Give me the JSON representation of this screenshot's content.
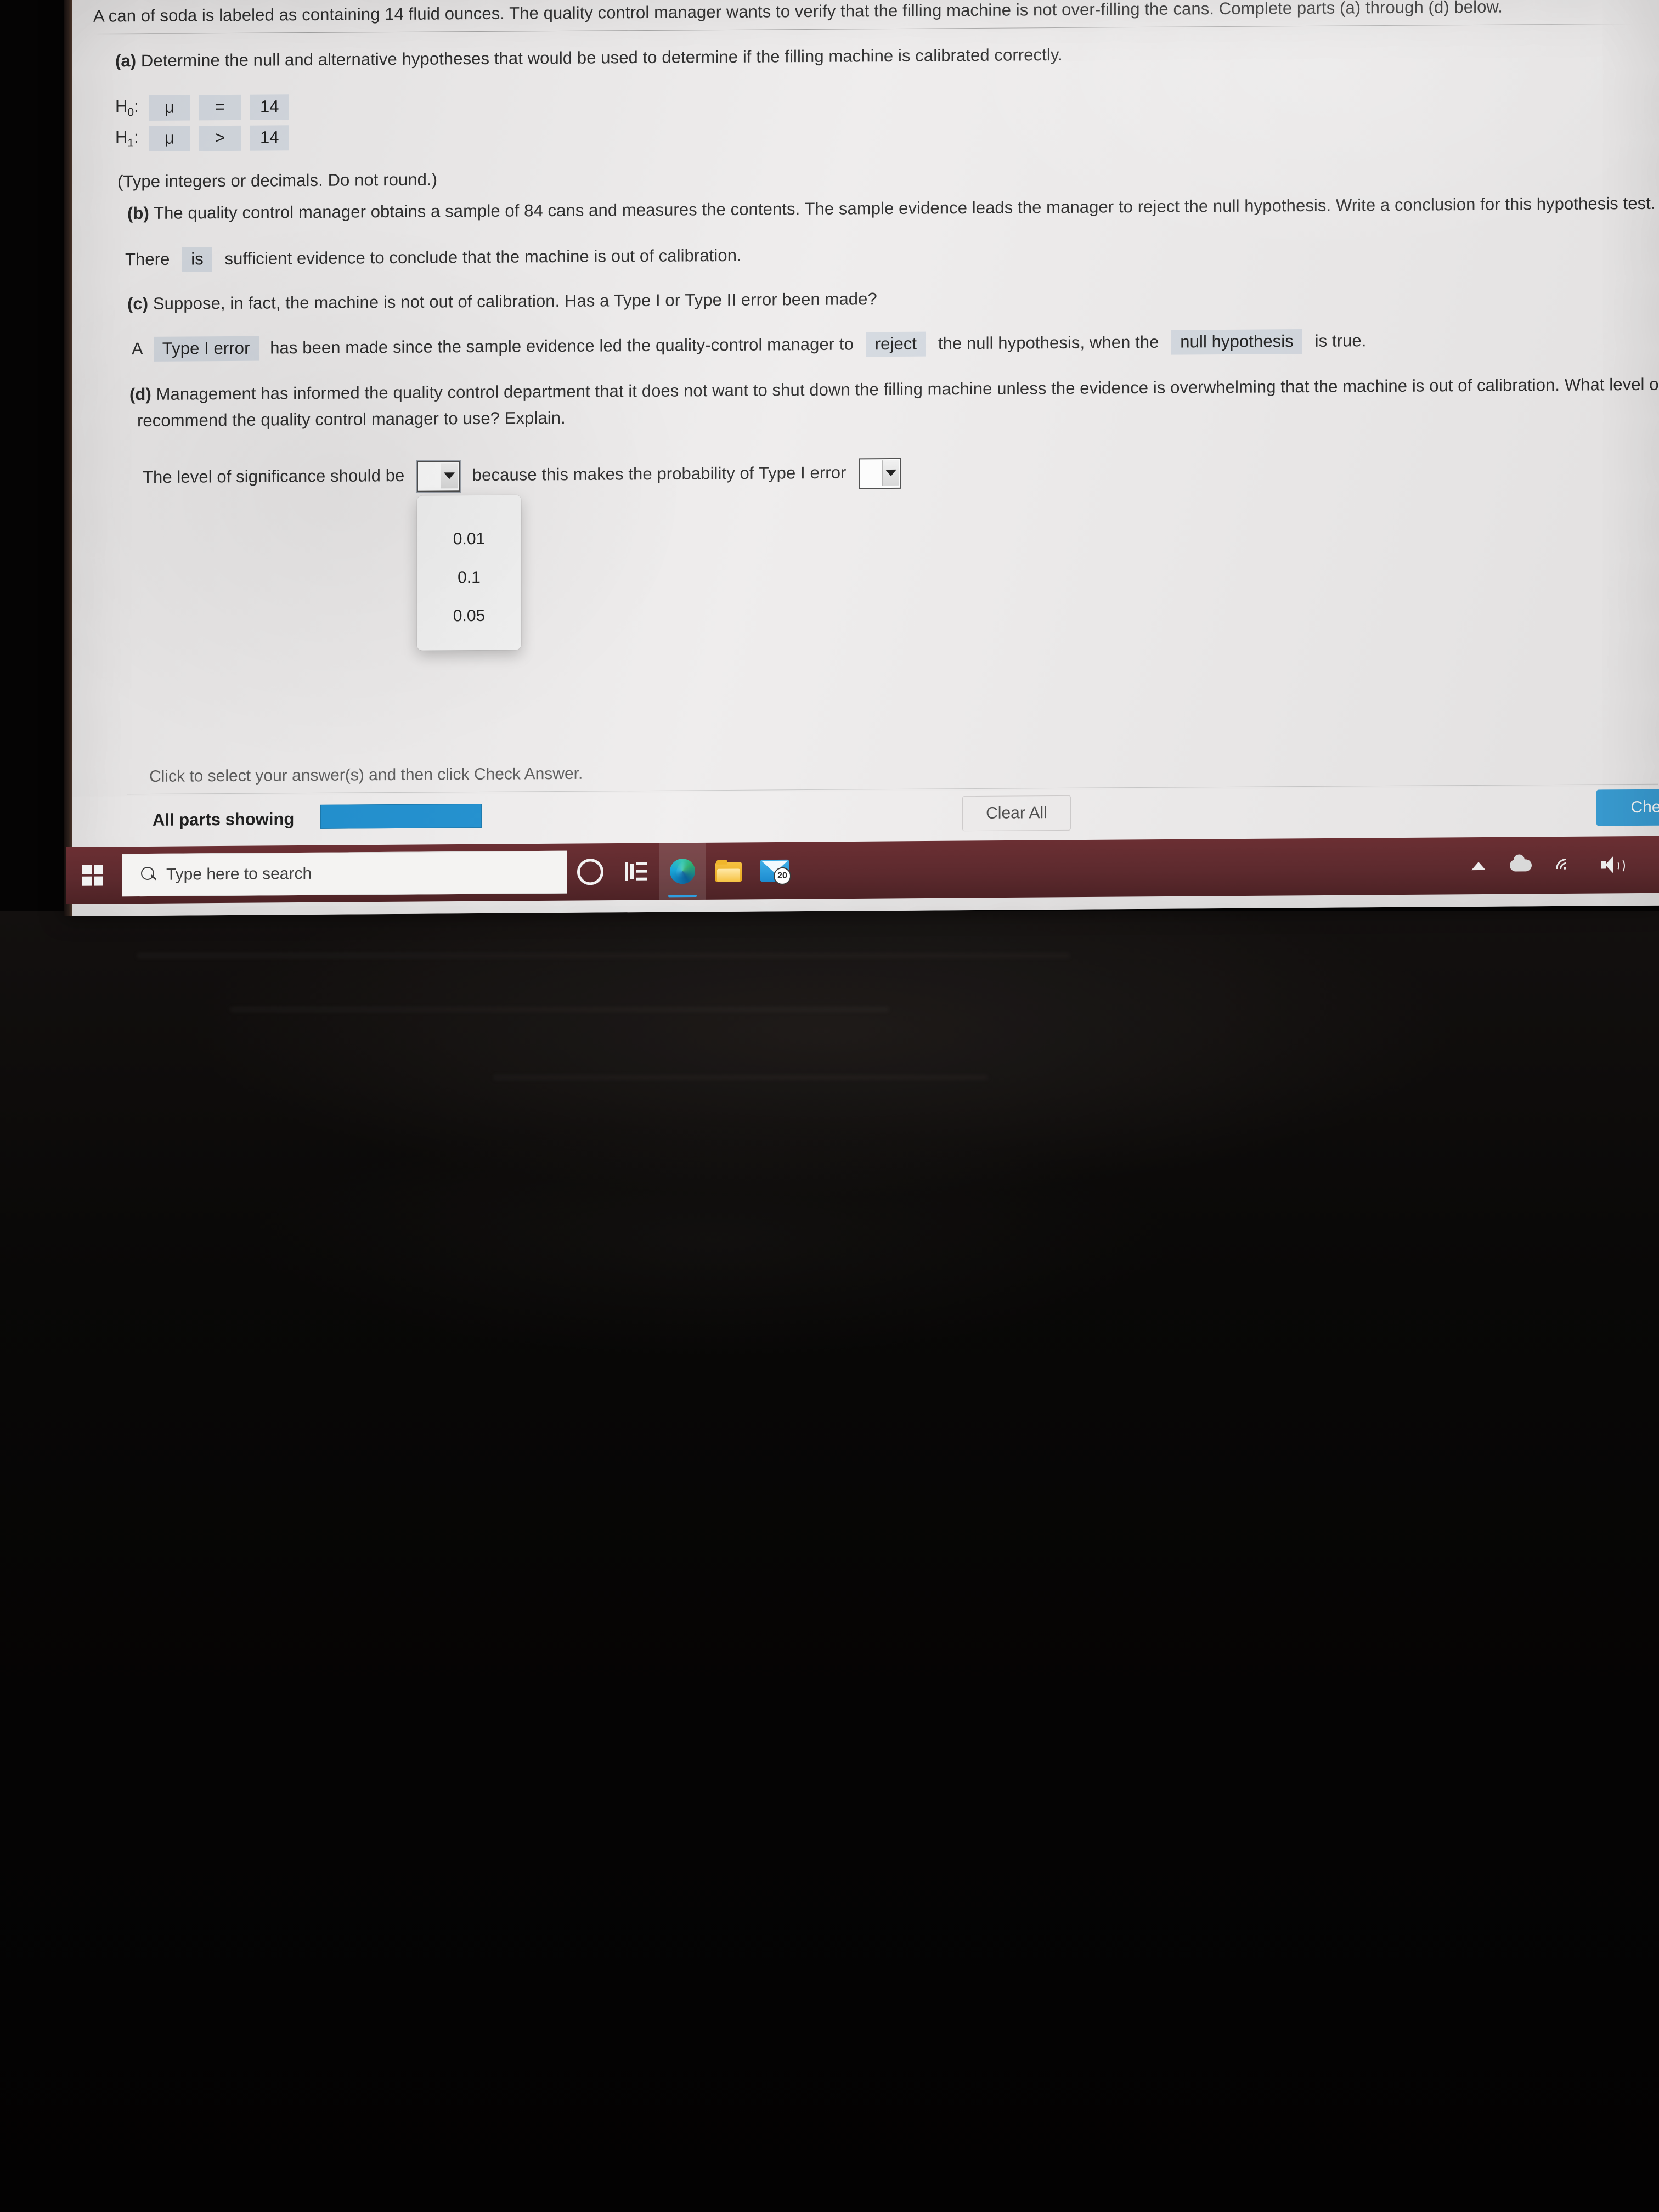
{
  "problem": {
    "stem": "A can of soda is labeled as containing 14 fluid ounces. The quality control manager wants to verify that the filling machine is not over-filling the cans. Complete parts (a) through (d) below.",
    "part_a": {
      "label": "(a)",
      "text": "Determine the null and alternative hypotheses that would be used to determine if the filling machine is calibrated correctly.",
      "h0_label": "H0:",
      "h0_param": "μ",
      "h0_operator": "=",
      "h0_value": "14",
      "h1_label": "H1:",
      "h1_param": "μ",
      "h1_operator": ">",
      "h1_value": "14",
      "note": "(Type integers or decimals. Do not round.)"
    },
    "part_b": {
      "label": "(b)",
      "text": "The quality control manager obtains a sample of 84 cans and measures the contents. The sample evidence leads the manager to reject the null hypothesis. Write a conclusion for this hypothesis test.",
      "answer_prefix": "There",
      "answer_blank": "is",
      "answer_suffix": "sufficient evidence to conclude that the machine is out of calibration."
    },
    "part_c": {
      "label": "(c)",
      "text": "Suppose, in fact, the machine is not out of calibration. Has a Type I or Type II error been made?",
      "seg1": "A",
      "blank1": "Type I error",
      "seg2": "has been made since the sample evidence led the quality-control manager to",
      "blank2": "reject",
      "seg3": "the null hypothesis, when the",
      "blank3": "null hypothesis",
      "seg4": "is true."
    },
    "part_d": {
      "label": "(d)",
      "text_line1": "Management has informed the quality control department that it does not want to shut down the filling machine unless the evidence is overwhelming that the machine is out of calibration. What level of sig",
      "text_line2": "recommend the quality control manager to use? Explain.",
      "sentence_prefix": "The level of significance should be",
      "sentence_middle": "because this makes the probability of Type I error",
      "dropdown_options": [
        "0.01",
        "0.1",
        "0.05"
      ],
      "dropdown_selected": ""
    }
  },
  "footer": {
    "hint": "Click to select your answer(s) and then click Check Answer.",
    "parts_label": "All parts showing",
    "clear_all": "Clear All",
    "check_answer": "Check"
  },
  "taskbar": {
    "search_placeholder": "Type here to search",
    "mail_badge": "20",
    "icons": [
      "start-icon",
      "search-icon",
      "cortana-icon",
      "task-view-icon",
      "edge-icon",
      "file-explorer-icon",
      "mail-icon"
    ],
    "tray_icons": [
      "show-hidden-icons-chevron",
      "onedrive-cloud-icon",
      "network-wifi-icon",
      "volume-speaker-icon"
    ]
  },
  "colors": {
    "accent_blue": "#1d8fd0",
    "check_button": "#3aa0d8",
    "answer_blank": "#d4d9e0",
    "taskbar": "#5d2a2e"
  }
}
